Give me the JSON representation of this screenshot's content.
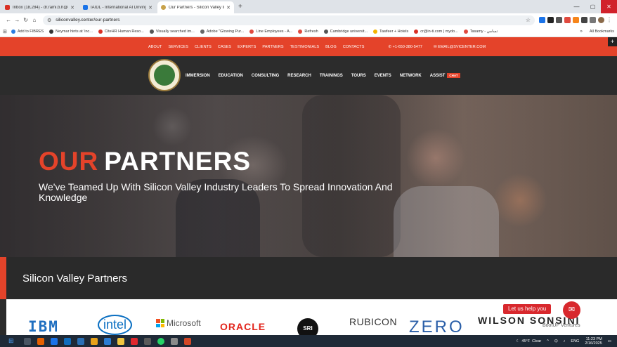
{
  "browser": {
    "tabs": [
      {
        "title": "Inbox (18,284) - dr.rami.b.h@gm...",
        "icon": "gmail-icon",
        "color": "#d93025",
        "active": false
      },
      {
        "title": "IAIDL - International AI Driving...",
        "icon": "iaidl-icon",
        "color": "#1a73e8",
        "active": false
      },
      {
        "title": "Our Partners - Silicon Valley Inn...",
        "icon": "svic-icon",
        "color": "#c8a24a",
        "active": true
      }
    ],
    "new_tab": "+",
    "window_controls": {
      "minimize": "—",
      "maximize": "▢",
      "close": "✕"
    },
    "toolbar": {
      "back": "←",
      "forward": "→",
      "reload": "↻",
      "home": "⌂",
      "url": "siliconvalley.center/our-partners",
      "star": "☆"
    },
    "bookmarks": [
      "Add to FIBRES",
      "Neymar hints at 'inc...",
      "CiteHR Human Reso...",
      "Visually searched im...",
      "Adobe \"Glowing Pur...",
      "Line Employees - A...",
      "Refresh",
      "Cambridge universit...",
      "Tawfeer + Hotels",
      "cr@in-ti.com | mydo...",
      "Tasamy - تسامي"
    ],
    "bookmarks_more": "»",
    "all_bookmarks": "All Bookmarks"
  },
  "site": {
    "topnav": [
      "ABOUT",
      "SERVICES",
      "CLIENTS",
      "CASES",
      "EXPERTS",
      "PARTNERS",
      "TESTIMONIALS",
      "BLOG",
      "CONTACTS"
    ],
    "phone": "+1-650-380-5477",
    "email": "EMAIL@SVICENTER.COM",
    "corner_plus": "+",
    "menu": [
      "IMMERSION",
      "EDUCATION",
      "CONSULTING",
      "RESEARCH",
      "TRAININGS",
      "TOURS",
      "EVENTS",
      "NETWORK"
    ],
    "assist": "ASSIST",
    "chat_badge": "CHAT",
    "hero": {
      "title_accent": "OUR",
      "title_rest": "PARTNERS",
      "subtitle": "We've Teamed Up With Silicon Valley Industry Leaders To Spread Innovation And Knowledge"
    },
    "section_title": "Silicon Valley Partners",
    "partner_logos": {
      "ibm": "IBM",
      "intel": "intel",
      "microsoft": "Microsoft",
      "oracle": "ORACLE",
      "sri": "SRI",
      "rubicon": "RUBICON",
      "zero": "ZERO",
      "wilson": "WILSON SONSINI",
      "bootup": "BootUP Ventures"
    },
    "help_text": "Let us help you"
  },
  "taskbar": {
    "weather": "45°F",
    "weather_label": "Clear",
    "lang": "ENG",
    "time": "11:23 PM",
    "date": "2/16/2025"
  }
}
